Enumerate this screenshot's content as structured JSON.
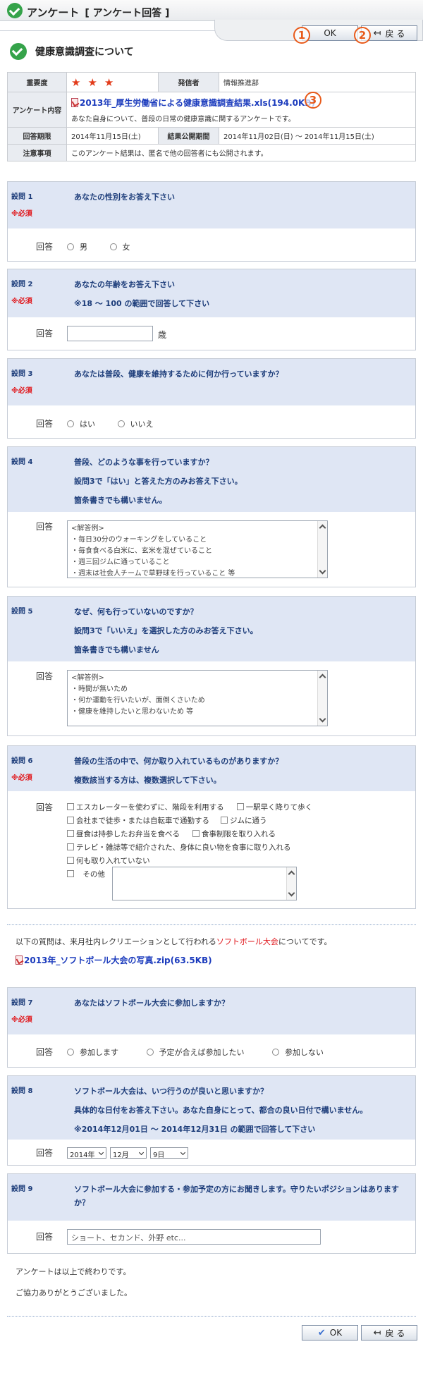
{
  "header": {
    "title": "アンケート",
    "subtitle": "[ アンケート回答 ]",
    "ok_label": "OK",
    "back_label": "戻 る",
    "marker_ok": "1",
    "marker_back": "2",
    "marker_file": "3"
  },
  "survey": {
    "title": "健康意識調査について",
    "labels": {
      "importance": "重要度",
      "sender": "発信者",
      "content": "アンケート内容",
      "period": "回答期限",
      "publish": "結果公開期間",
      "notes": "注意事項"
    },
    "stars": [
      "★",
      "★",
      "★"
    ],
    "sender": "情報推進部",
    "file": "2013年_厚生労働省による健康意識調査結果.xls(194.0KB)",
    "description": "あなた自身について、普段の日常の健康意識に関するアンケートです。",
    "deadline": "2014年11月15日(土)",
    "publish_period": "2014年11月02日(日) ～ 2014年11月15日(土)",
    "notes_text": "このアンケート結果は、匿名で他の回答者にも公開されます。"
  },
  "common": {
    "answer_label": "回答",
    "required_label": "※必須"
  },
  "q1": {
    "num": "設問 1",
    "text": "あなたの性別をお答え下さい",
    "opt1": "男",
    "opt2": "女"
  },
  "q2": {
    "num": "設問 2",
    "text": "あなたの年齢をお答え下さい",
    "sub": "※18 ～ 100 の範囲で回答して下さい",
    "unit": "歳",
    "value": ""
  },
  "q3": {
    "num": "設問 3",
    "text": "あなたは普段、健康を維持するために何か行っていますか？",
    "opt1": "はい",
    "opt2": "いいえ"
  },
  "q4": {
    "num": "設問 4",
    "text": "普段、どのような事を行っていますか？",
    "sub1": "設問3で「はい」と答えた方のみお答え下さい。",
    "sub2": "箇条書きでも構いません。",
    "lines": [
      "<解答例>",
      "・毎日30分のウォーキングをしていること",
      "・毎食食べる白米に、玄米を混ぜていること",
      "・週三回ジムに通っていること",
      "・週末は社会人チームで草野球を行っていること 等"
    ]
  },
  "q5": {
    "num": "設問 5",
    "text": "なぜ、何も行っていないのですか？",
    "sub1": "設問3で「いいえ」を選択した方のみお答え下さい。",
    "sub2": "箇条書きでも構いません",
    "lines": [
      "<解答例>",
      "・時間が無いため",
      "・何か運動を行いたいが、面倒くさいため",
      "・健康を維持したいと思わないため 等"
    ]
  },
  "q6": {
    "num": "設問 6",
    "text": "普段の生活の中で、何か取り入れているものがありますか？",
    "sub": "複数該当する方は、複数選択して下さい。",
    "c1": "エスカレーターを使わずに、階段を利用する",
    "c2": "一駅早く降りて歩く",
    "c3": "会社まで徒歩・または自転車で通勤する",
    "c4": "ジムに通う",
    "c5": "昼食は持参したお弁当を食べる",
    "c6": "食事制限を取り入れる",
    "c7": "テレビ・雑誌等で紹介された、身体に良い物を食事に取り入れる",
    "c8": "何も取り入れていない",
    "c9": "その他"
  },
  "intermission": {
    "text_before": "以下の質問は、来月社内レクリエーションとして行われる",
    "highlight": "ソフトボール大会",
    "text_after": "についてです。",
    "file": "2013年_ソフトボール大会の写真.zip(63.5KB)"
  },
  "q7": {
    "num": "設問 7",
    "text": "あなたはソフトボール大会に参加しますか？",
    "opt1": "参加します",
    "opt2": "予定が合えば参加したい",
    "opt3": "参加しない"
  },
  "q8": {
    "num": "設問 8",
    "text": "ソフトボール大会は、いつ行うのが良いと思いますか？",
    "sub1": "具体的な日付をお答え下さい。あなた自身にとって、都合の良い日付で構いません。",
    "sub2": "※2014年12月01日 ～ 2014年12月31日 の範囲で回答して下さい",
    "year": "2014年",
    "month": "12月",
    "day": "9日"
  },
  "q9": {
    "num": "設問 9",
    "text": "ソフトボール大会に参加する・参加予定の方にお聞きします。守りたいポジションはありますか？",
    "placeholder": "ショート、セカンド、外野 etc..."
  },
  "footer": {
    "end1": "アンケートは以上で終わりです。",
    "end2": "ご協力ありがとうございました。",
    "ok_label": "OK",
    "back_label": "戻 る"
  }
}
